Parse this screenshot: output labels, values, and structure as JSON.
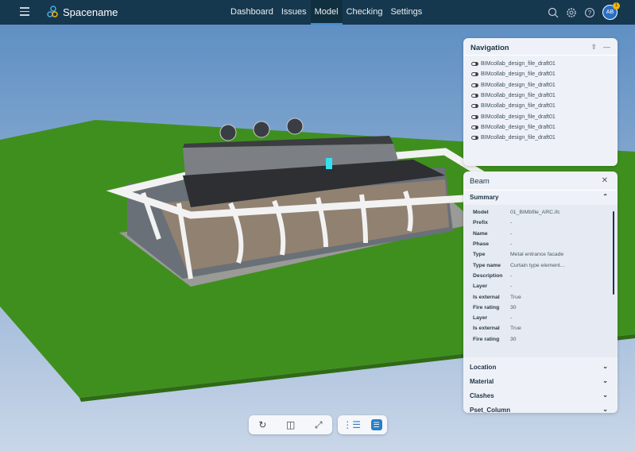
{
  "topbar": {
    "app_name": "Spacename",
    "nav": [
      "Dashboard",
      "Issues",
      "Model",
      "Checking",
      "Settings"
    ],
    "active": "Model",
    "avatar": "AB",
    "notifications": "1"
  },
  "navigation": {
    "title": "Navigation",
    "items": [
      "BIMcollab_design_file_draft01",
      "BIMcollab_design_file_draft01",
      "BIMcollab_design_file_draft01",
      "BIMcollab_design_file_draft01",
      "BIMcollab_design_file_draft01",
      "BIMcollab_design_file_draft01",
      "BIMcollab_design_file_draft01",
      "BIMcollab_design_file_draft01"
    ]
  },
  "properties": {
    "title": "Beam",
    "summary": "Summary",
    "rows": [
      {
        "k": "Model",
        "v": "01_BIMbfile_ARC.ifc"
      },
      {
        "k": "Prefix",
        "v": "-"
      },
      {
        "k": "Name",
        "v": "-"
      },
      {
        "k": "Phase",
        "v": "-"
      },
      {
        "k": "Type",
        "v": "Metal entrance facade"
      },
      {
        "k": "Type name",
        "v": "Curtain type element..."
      },
      {
        "k": "Description",
        "v": "-"
      },
      {
        "k": "Layer",
        "v": "-"
      },
      {
        "k": "Is external",
        "v": "True"
      },
      {
        "k": "Fire rating",
        "v": "30"
      },
      {
        "k": "Layer",
        "v": "-"
      },
      {
        "k": "Is external",
        "v": "True"
      },
      {
        "k": "Fire rating",
        "v": "30"
      }
    ],
    "sections": [
      "Location",
      "Material",
      "Clashes",
      "Pset_Column"
    ]
  },
  "colors": {
    "topbar": "#16384f",
    "accent": "#3a8ed8",
    "ground": "#3f8f1f"
  }
}
